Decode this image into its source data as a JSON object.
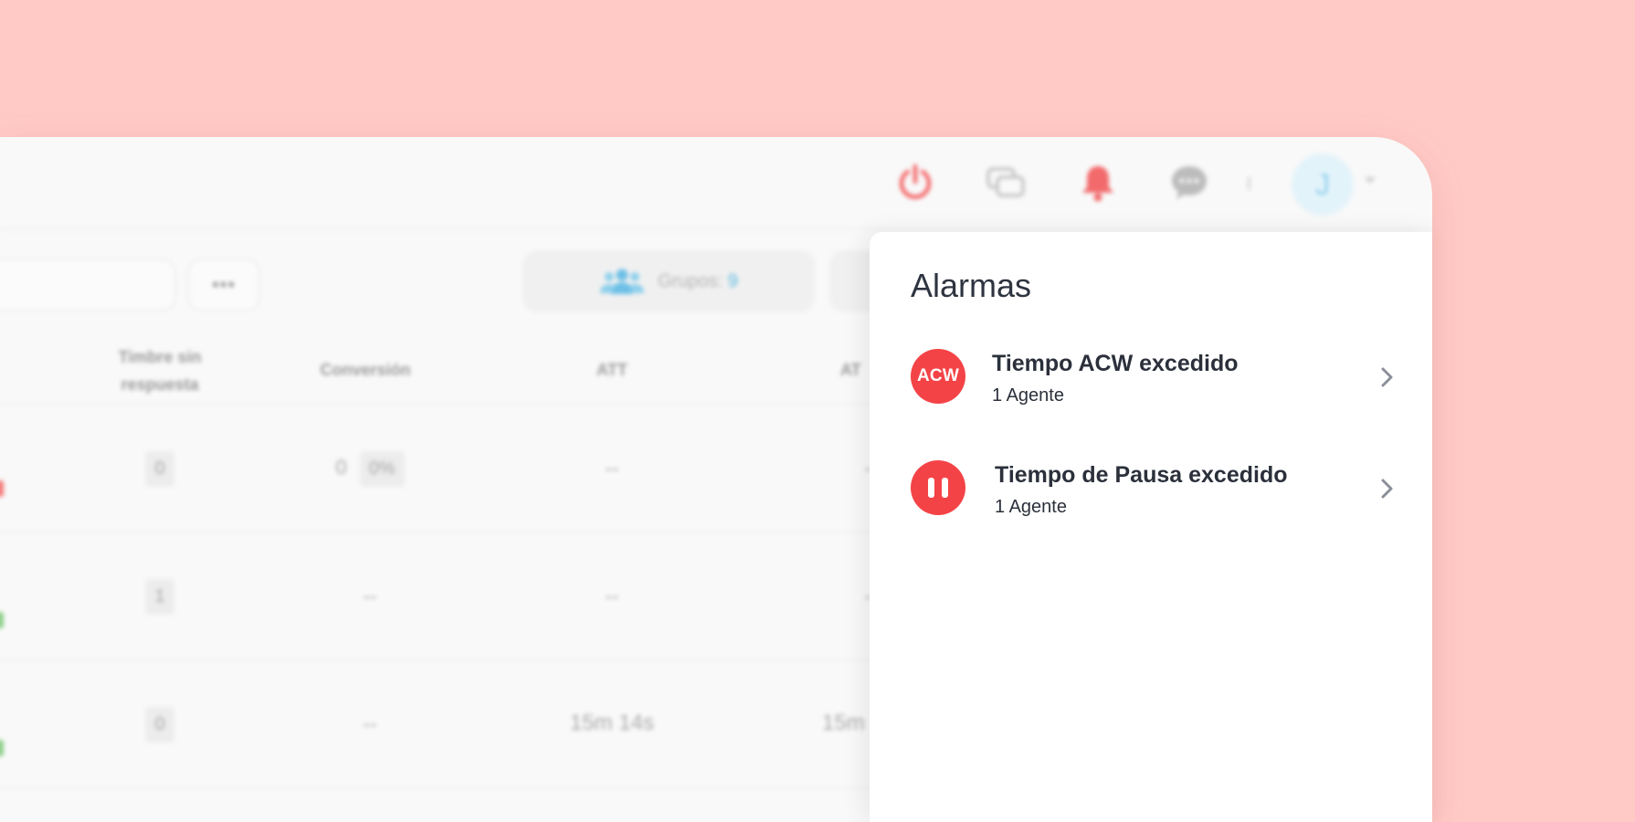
{
  "header": {
    "avatar_initial": "J"
  },
  "toolbar": {
    "more_label": "•••",
    "groups_label": "Grupos:",
    "groups_count": "9"
  },
  "table": {
    "columns": [
      "Timbre sin respuesta",
      "Conversión",
      "ATT",
      "AT"
    ],
    "rows": [
      {
        "no_answer": "0",
        "conversion": "0",
        "conversion_pct": "0%",
        "att": "--",
        "at": "-"
      },
      {
        "no_answer": "1",
        "conversion": "--",
        "att": "--",
        "at": "-"
      },
      {
        "no_answer": "0",
        "conversion": "--",
        "att": "15m 14s",
        "at": "15m"
      }
    ]
  },
  "alarms_panel": {
    "title": "Alarmas",
    "items": [
      {
        "badge": "ACW",
        "title": "Tiempo ACW excedido",
        "subtitle": "1 Agente"
      },
      {
        "badge": "pause-icon",
        "title": "Tiempo de Pausa excedido",
        "subtitle": "1 Agente"
      }
    ]
  },
  "colors": {
    "background": "#ffcac6",
    "alarm_red": "#f44346",
    "accent_blue": "#5ab7e0"
  }
}
